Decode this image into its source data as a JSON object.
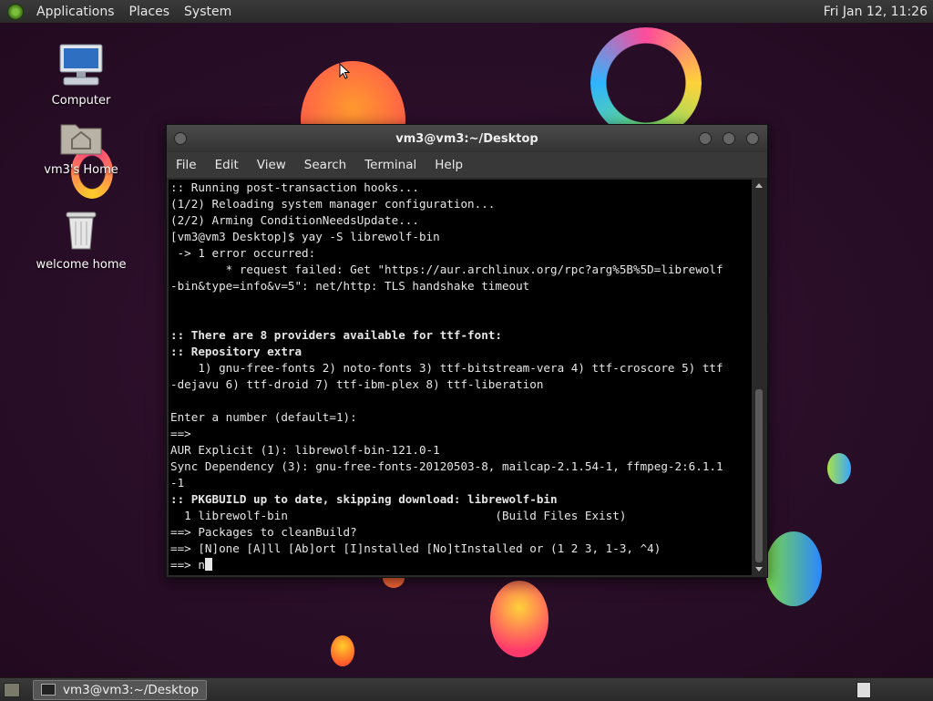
{
  "top_panel": {
    "menus": [
      "Applications",
      "Places",
      "System"
    ],
    "clock": "Fri Jan 12, 11:26"
  },
  "desktop_icons": [
    {
      "label": "Computer",
      "icon": "computer-icon"
    },
    {
      "label": "vm3's Home",
      "icon": "home-folder-icon"
    },
    {
      "label": "welcome home",
      "icon": "trash-icon"
    }
  ],
  "terminal": {
    "title": "vm3@vm3:~/Desktop",
    "menu": [
      "File",
      "Edit",
      "View",
      "Search",
      "Terminal",
      "Help"
    ],
    "lines": [
      ":: Running post-transaction hooks...",
      "(1/2) Reloading system manager configuration...",
      "(2/2) Arming ConditionNeedsUpdate...",
      "[vm3@vm3 Desktop]$ yay -S librewolf-bin",
      " -> 1 error occurred:",
      "        * request failed: Get \"https://aur.archlinux.org/rpc?arg%5B%5D=librewolf",
      "-bin&type=info&v=5\": net/http: TLS handshake timeout",
      "",
      "",
      ":: There are 8 providers available for ttf-font:",
      ":: Repository extra",
      "    1) gnu-free-fonts 2) noto-fonts 3) ttf-bitstream-vera 4) ttf-croscore 5) ttf",
      "-dejavu 6) ttf-droid 7) ttf-ibm-plex 8) ttf-liberation",
      "",
      "Enter a number (default=1):",
      "==>",
      "AUR Explicit (1): librewolf-bin-121.0-1",
      "Sync Dependency (3): gnu-free-fonts-20120503-8, mailcap-2.1.54-1, ffmpeg-2:6.1.1",
      "-1",
      ":: PKGBUILD up to date, skipping download: librewolf-bin",
      "  1 librewolf-bin                              (Build Files Exist)",
      "==> Packages to cleanBuild?",
      "==> [N]one [A]ll [Ab]ort [I]nstalled [No]tInstalled or (1 2 3, 1-3, ^4)",
      "==> n"
    ],
    "bold_lines": [
      9,
      10,
      19
    ]
  },
  "bottom_panel": {
    "task_label": "vm3@vm3:~/Desktop"
  },
  "colors": {
    "desktop_bg": "#2a0e28",
    "terminal_bg": "#000000",
    "terminal_fg": "#e6e6e6"
  }
}
